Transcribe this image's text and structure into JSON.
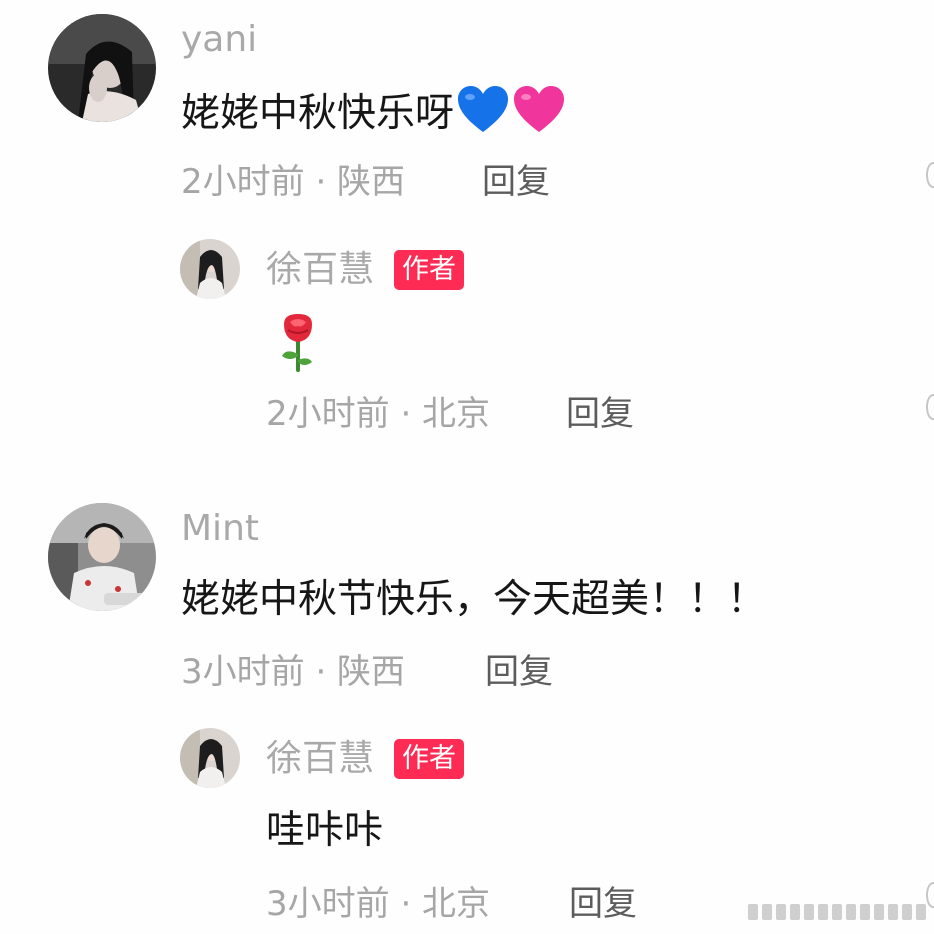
{
  "comments": [
    {
      "username": "yani",
      "text": "姥姥中秋快乐呀",
      "emoji": [
        "blue-heart",
        "pink-heart"
      ],
      "time": "2小时前 · 陕西",
      "reply_label": "回复",
      "reply": {
        "username": "徐百慧",
        "badge": "作者",
        "emoji": "rose",
        "time": "2小时前 · 北京",
        "reply_label": "回复"
      }
    },
    {
      "username": "Mint",
      "text": "姥姥中秋节快乐，今天超美！！！",
      "time": "3小时前 · 陕西",
      "reply_label": "回复",
      "reply": {
        "username": "徐百慧",
        "badge": "作者",
        "text": "哇咔咔",
        "time": "3小时前 · 北京",
        "reply_label": "回复"
      }
    }
  ],
  "colors": {
    "badge": "#fe2c55",
    "username": "#a9a9a9",
    "text": "#161616",
    "meta": "#a6a6a6",
    "reply": "#5c5c5c"
  }
}
